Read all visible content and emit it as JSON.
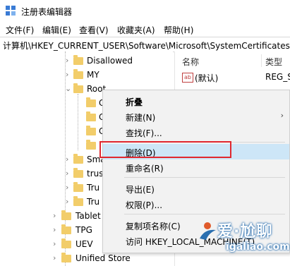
{
  "window": {
    "title": "注册表编辑器",
    "icon": "registry-editor-icon"
  },
  "menubar": {
    "items": [
      "文件(F)",
      "编辑(E)",
      "查看(V)",
      "收藏夹(A)",
      "帮助(H)"
    ]
  },
  "address": {
    "path": "计算机\\HKEY_CURRENT_USER\\Software\\Microsoft\\SystemCertificates\\R"
  },
  "tree": {
    "items": [
      {
        "label": "Disallowed",
        "expandable": true
      },
      {
        "label": "MY",
        "expandable": true
      },
      {
        "label": "Root",
        "expandable": true,
        "expanded": true
      },
      {
        "label": "C",
        "expandable": false
      },
      {
        "label": "C",
        "expandable": false
      },
      {
        "label": "C",
        "expandable": false
      },
      {
        "label": "",
        "expandable": false
      },
      {
        "label": "Sma",
        "expandable": true
      },
      {
        "label": "trus",
        "expandable": true
      },
      {
        "label": "Tru",
        "expandable": true
      },
      {
        "label": "Tru",
        "expandable": true
      },
      {
        "label": "Tablet",
        "expandable": true
      },
      {
        "label": "TPG",
        "expandable": true
      },
      {
        "label": "UEV",
        "expandable": true
      },
      {
        "label": "Unified Store",
        "expandable": true
      }
    ]
  },
  "values_pane": {
    "headers": {
      "name": "名称",
      "type": "类型"
    },
    "rows": [
      {
        "name": "(默认)",
        "type": "REG_S",
        "icon": "ab-string-icon"
      }
    ]
  },
  "context_menu": {
    "items": [
      {
        "label": "折叠",
        "bold": true
      },
      {
        "label": "新建(N)",
        "submenu": true
      },
      {
        "label": "查找(F)..."
      },
      {
        "label": "删除(D)",
        "highlighted": true
      },
      {
        "label": "重命名(R)"
      },
      {
        "label": "导出(E)"
      },
      {
        "label": "权限(P)..."
      },
      {
        "label": "复制项名称(C)"
      },
      {
        "label": "访问 HKEY_LOCAL_MACHINE(T)"
      }
    ],
    "highlight_color": "#cde6f7",
    "annotation_color": "#e0282f"
  },
  "watermark": {
    "line1": "爱·尬聊",
    "line2": "igaliao.com"
  }
}
